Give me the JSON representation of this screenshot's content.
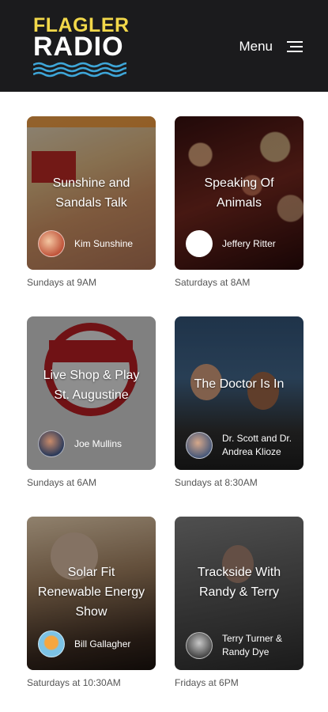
{
  "header": {
    "logo_line1": "FLAGLER",
    "logo_line2": "RADIO",
    "menu_label": "Menu",
    "background": "#1b1b1d",
    "logo_yellow": "#f2d84a",
    "logo_blue": "#3ea6d8"
  },
  "shows": [
    {
      "title": "Sunshine and Sandals Talk",
      "host": "Kim Sunshine",
      "schedule": "Sundays at 9AM"
    },
    {
      "title": "Speaking Of Animals",
      "host": "Jeffery Ritter",
      "schedule": "Saturdays at 8AM"
    },
    {
      "title": "Live Shop & Play St. Augustine",
      "host": "Joe Mullins",
      "schedule": "Sundays at 6AM"
    },
    {
      "title": "The Doctor Is In",
      "host": "Dr. Scott and Dr. Andrea Klioze",
      "schedule": "Sundays at 8:30AM"
    },
    {
      "title": "Solar Fit Renewable Energy Show",
      "host": "Bill Gallagher",
      "schedule": "Saturdays at 10:30AM"
    },
    {
      "title": "Trackside With Randy & Terry",
      "host": "Terry Turner & Randy Dye",
      "schedule": "Fridays at 6PM"
    }
  ]
}
